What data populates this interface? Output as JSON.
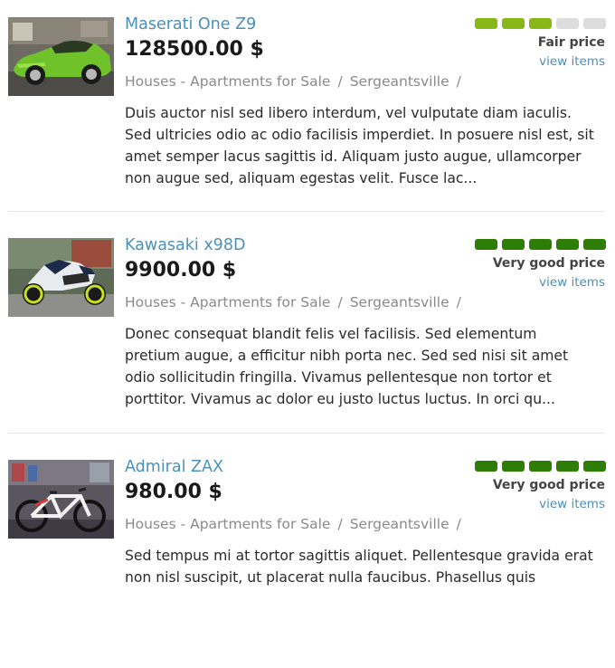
{
  "colors": {
    "link": "#4a90b8",
    "muted": "#8a8a8a",
    "rating_fair": "#88b818",
    "rating_good": "#2e7d06",
    "rating_empty": "#dddddd"
  },
  "listings": [
    {
      "title": "Maserati One Z9",
      "price": "128500.00 $",
      "category": "Houses - Apartments for Sale",
      "location": "Sergeantsville",
      "separator": "/",
      "description": "Duis auctor nisl sed libero interdum, vel vulputate diam iaculis. Sed ultricies odio ac odio facilisis imperdiet. In posuere nisl est, sit amet semper lacus sagittis id. Aliquam justo augue, ullamcorper non augue sed, aliquam egestas velit. Fusce lac...",
      "rating_label": "Fair price",
      "rating_level": 3,
      "rating_max": 5,
      "rating_color": "#88b818",
      "view_link": "view items",
      "image": "green-sports-car-photo"
    },
    {
      "title": "Kawasaki x98D",
      "price": "9900.00 $",
      "category": "Houses - Apartments for Sale",
      "location": "Sergeantsville",
      "separator": "/",
      "description": "Donec consequat blandit felis vel facilisis. Sed elementum pretium augue, a efficitur nibh porta nec. Sed sed nisi sit amet odio sollicitudin fringilla. Vivamus pellentesque non tortor et porttitor. Vivamus ac dolor eu justo luctus luctus. In orci qu...",
      "rating_label": "Very good price",
      "rating_level": 5,
      "rating_max": 5,
      "rating_color": "#2e7d06",
      "view_link": "view items",
      "image": "sport-motorcycle-photo"
    },
    {
      "title": "Admiral ZAX",
      "price": "980.00 $",
      "category": "Houses - Apartments for Sale",
      "location": "Sergeantsville",
      "separator": "/",
      "description": "Sed tempus mi at tortor sagittis aliquet. Pellentesque gravida erat non nisl suscipit, ut placerat nulla faucibus. Phasellus quis",
      "rating_label": "Very good price",
      "rating_level": 5,
      "rating_max": 5,
      "rating_color": "#2e7d06",
      "view_link": "view items",
      "image": "bicycle-photo"
    }
  ]
}
